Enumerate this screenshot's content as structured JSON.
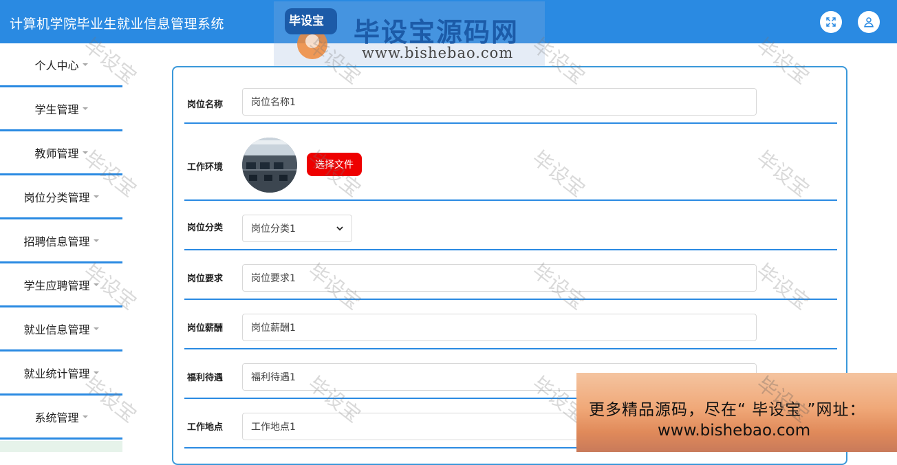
{
  "header": {
    "title": "计算机学院毕业生就业信息管理系统",
    "fullscreen_icon": "expand-icon",
    "user_icon": "user-icon"
  },
  "logo": {
    "badge_text": "毕设宝",
    "name": "毕设宝源码网",
    "url": "www.bishebao.com"
  },
  "sidebar": {
    "items": [
      {
        "label": "个人中心"
      },
      {
        "label": "学生管理"
      },
      {
        "label": "教师管理"
      },
      {
        "label": "岗位分类管理"
      },
      {
        "label": "招聘信息管理"
      },
      {
        "label": "学生应聘管理"
      },
      {
        "label": "就业信息管理"
      },
      {
        "label": "就业统计管理"
      },
      {
        "label": "系统管理"
      }
    ]
  },
  "form": {
    "job_name": {
      "label": "岗位名称",
      "value": "岗位名称1"
    },
    "environment": {
      "label": "工作环境",
      "button": "选择文件"
    },
    "category": {
      "label": "岗位分类",
      "value": "岗位分类1"
    },
    "requirement": {
      "label": "岗位要求",
      "value": "岗位要求1"
    },
    "salary": {
      "label": "岗位薪酬",
      "value": "岗位薪酬1"
    },
    "benefits": {
      "label": "福利待遇",
      "value": "福利待遇1"
    },
    "location": {
      "label": "工作地点",
      "value": "工作地点1"
    }
  },
  "watermark": "毕设宝",
  "promo": {
    "line1": "更多精品源码，尽在“ 毕设宝 ”网址：",
    "line2": "www.bishebao.com"
  },
  "colors": {
    "primary": "#2a8ae2",
    "file_button": "#ee0000"
  }
}
